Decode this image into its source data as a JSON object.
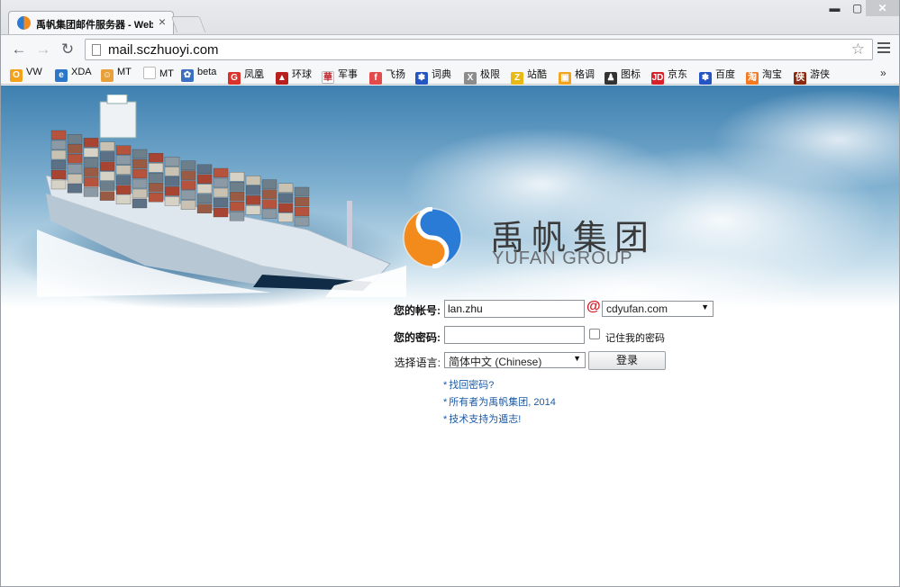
{
  "browser": {
    "tab_title": "禹帆集团邮件服务器 - Webmail",
    "tab_close": "×",
    "window_controls": {
      "minimize": "▬",
      "maximize": "▢",
      "close": "✕"
    },
    "url": "mail.sczhuoyi.com",
    "nav": {
      "back": "←",
      "forward": "→",
      "reload": "↻",
      "star": "☆"
    },
    "bookmarks_more": "»",
    "bookmarks": [
      {
        "label": "VW",
        "icon": "O",
        "color": "#f4a21b"
      },
      {
        "label": "XDA",
        "icon": "e",
        "color": "#2b77c8"
      },
      {
        "label": "MT",
        "icon": "☺",
        "color": "#e8a13a"
      },
      {
        "label": "MT",
        "icon": "",
        "color": "#ffffff"
      },
      {
        "label": "beta",
        "icon": "✿",
        "color": "#3b6fc2"
      },
      {
        "label": "凤凰",
        "icon": "G",
        "color": "#d9332b"
      },
      {
        "label": "环球",
        "icon": "▲",
        "color": "#b81f1f"
      },
      {
        "label": "军事",
        "icon": "華",
        "color": "#ffffff"
      },
      {
        "label": "飞扬",
        "icon": "f",
        "color": "#e24b4b"
      },
      {
        "label": "词典",
        "icon": "✽",
        "color": "#2455c3"
      },
      {
        "label": "极限",
        "icon": "X",
        "color": "#8c8c8c"
      },
      {
        "label": "站酷",
        "icon": "Z",
        "color": "#e8b815"
      },
      {
        "label": "格调",
        "icon": "▣",
        "color": "#f2a41f"
      },
      {
        "label": "图标",
        "icon": "♟",
        "color": "#333333"
      },
      {
        "label": "京东",
        "icon": "JD",
        "color": "#d7222b"
      },
      {
        "label": "百度",
        "icon": "✽",
        "color": "#2455c3"
      },
      {
        "label": "淘宝",
        "icon": "淘",
        "color": "#f47920"
      },
      {
        "label": "游侠",
        "icon": "侠",
        "color": "#8b2a12"
      }
    ]
  },
  "brand": {
    "name_cn": "禹帆集团",
    "name_en": "YUFAN GROUP",
    "colors": {
      "orange": "#f28a1c",
      "blue": "#2a7bd6"
    }
  },
  "login": {
    "account_label": "您的帐号:",
    "account_value": "lan.zhu",
    "at_sign": "@",
    "domain_value": "cdyufan.com",
    "password_label": "您的密码:",
    "password_value": "",
    "remember_label": "记住我的密码",
    "remember_checked": false,
    "language_label": "选择语言:",
    "language_value": "简体中文 (Chinese)",
    "submit_label": "登录",
    "dropdown_arrow": "▼"
  },
  "links": [
    {
      "bullet": "*",
      "text": "找回密码?"
    },
    {
      "bullet": "*",
      "text": "所有者为禹帆集团, 2014"
    },
    {
      "bullet": "*",
      "text": "技术支持为遁志!"
    }
  ]
}
